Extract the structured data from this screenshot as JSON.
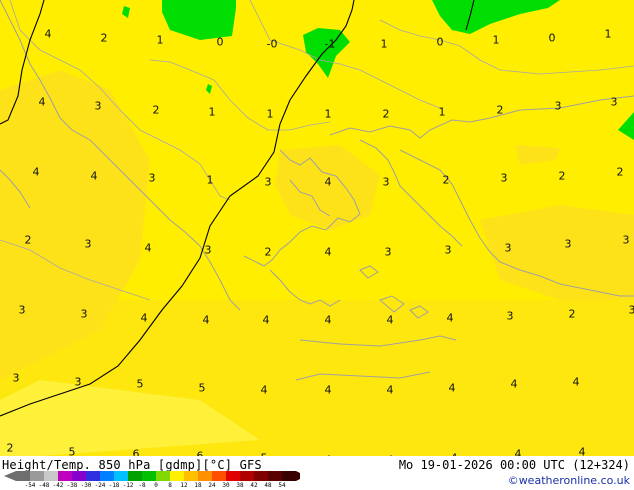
{
  "map": {
    "colors": {
      "fill_band_0_4": "#ffee00",
      "fill_band_4_8": "#fff03a",
      "fill_band_m4_0": "#00dd00",
      "warm_patch": "#fde21a",
      "coastline": "#a0a0a0",
      "border": "#a8a8a8",
      "zero_isotherm": "#000000"
    },
    "values": [
      {
        "v": "4"
      },
      {
        "v": "2"
      },
      {
        "v": "1"
      },
      {
        "v": "0"
      },
      {
        "v": "-0"
      },
      {
        "v": "-1"
      },
      {
        "v": "1"
      },
      {
        "v": "0"
      },
      {
        "v": "1"
      },
      {
        "v": "0"
      },
      {
        "v": "1"
      },
      {
        "v": "4"
      },
      {
        "v": "3"
      },
      {
        "v": "2"
      },
      {
        "v": "1"
      },
      {
        "v": "1"
      },
      {
        "v": "1"
      },
      {
        "v": "2"
      },
      {
        "v": "1"
      },
      {
        "v": "2"
      },
      {
        "v": "3"
      },
      {
        "v": "3"
      },
      {
        "v": "4"
      },
      {
        "v": "4"
      },
      {
        "v": "3"
      },
      {
        "v": "1"
      },
      {
        "v": "3"
      },
      {
        "v": "4"
      },
      {
        "v": "3"
      },
      {
        "v": "2"
      },
      {
        "v": "3"
      },
      {
        "v": "2"
      },
      {
        "v": "2"
      },
      {
        "v": "2"
      },
      {
        "v": "3"
      },
      {
        "v": "4"
      },
      {
        "v": "3"
      },
      {
        "v": "2"
      },
      {
        "v": "4"
      },
      {
        "v": "3"
      },
      {
        "v": "3"
      },
      {
        "v": "3"
      },
      {
        "v": "3"
      },
      {
        "v": "3"
      },
      {
        "v": "3"
      },
      {
        "v": "3"
      },
      {
        "v": "4"
      },
      {
        "v": "4"
      },
      {
        "v": "4"
      },
      {
        "v": "4"
      },
      {
        "v": "4"
      },
      {
        "v": "4"
      },
      {
        "v": "3"
      },
      {
        "v": "2"
      },
      {
        "v": "3"
      },
      {
        "v": "3"
      },
      {
        "v": "3"
      },
      {
        "v": "5"
      },
      {
        "v": "5"
      },
      {
        "v": "4"
      },
      {
        "v": "4"
      },
      {
        "v": "4"
      },
      {
        "v": "4"
      },
      {
        "v": "4"
      },
      {
        "v": "4"
      },
      {
        "v": "2"
      },
      {
        "v": "5"
      },
      {
        "v": "6"
      },
      {
        "v": "6"
      },
      {
        "v": "5"
      },
      {
        "v": "4"
      },
      {
        "v": "4"
      },
      {
        "v": "4"
      },
      {
        "v": "4"
      },
      {
        "v": "4"
      }
    ]
  },
  "footer": {
    "title": "Height/Temp. 850 hPa [gdmp][°C] GFS",
    "datetime": "Mo 19-01-2026 00:00 UTC (12+324)",
    "credit": "©weatheronline.co.uk"
  },
  "scale": {
    "ticks": [
      "-54",
      "-48",
      "-42",
      "-38",
      "-30",
      "-24",
      "-18",
      "-12",
      "-8",
      "0",
      "8",
      "12",
      "18",
      "24",
      "30",
      "38",
      "42",
      "48",
      "54"
    ],
    "colors": [
      "#6e6e6e",
      "#9a9a9a",
      "#c8c8c8",
      "#c000c0",
      "#8800cc",
      "#3030e0",
      "#0080ff",
      "#00c0ff",
      "#00a000",
      "#00c000",
      "#7fd800",
      "#fff000",
      "#ffc000",
      "#ff9000",
      "#ff5000",
      "#e00000",
      "#b00000",
      "#800000",
      "#5a0000",
      "#3a0000"
    ]
  }
}
